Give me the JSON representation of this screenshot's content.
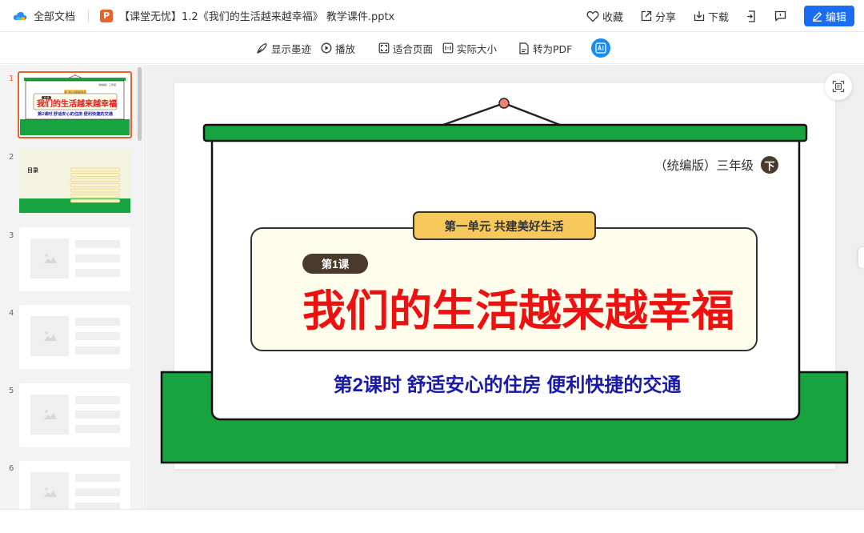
{
  "header": {
    "all_docs": "全部文档",
    "file_badge": "P",
    "doc_title": "【课堂无忧】1.2《我们的生活越来越幸福》 教学课件.pptx",
    "favorite": "收藏",
    "share": "分享",
    "download": "下载",
    "edit": "编辑"
  },
  "toolbar": {
    "show_ink": "显示墨迹",
    "play": "播放",
    "fit_page": "适合页面",
    "actual_size": "实际大小",
    "to_pdf": "转为PDF"
  },
  "thumbnails": {
    "numbers": [
      "1",
      "2",
      "3",
      "4",
      "5",
      "6"
    ],
    "t1_unit": "第一单元 共建美好生活",
    "t1_lesson": "第1课",
    "t1_title": "我们的生活越来越幸福",
    "t1_sub": "第2课时 舒适安心的住房 便利快捷的交通",
    "t1_grade": "（统编版）三年级",
    "t2_title": "目录"
  },
  "slide": {
    "grade": "（统编版）三年级",
    "grade_badge": "下",
    "unit": "第一单元  共建美好生活",
    "lesson": "第1课",
    "title": "我们的生活越来越幸福",
    "subtitle": "第2课时  舒适安心的住房  便利快捷的交通"
  },
  "colors": {
    "accent_orange": "#e8622a",
    "primary_blue": "#1a6cf0",
    "board_green": "#16a340",
    "title_red": "#ee1111",
    "subtitle_blue": "#1a1aa8",
    "tag_yellow": "#f7c95c",
    "cream": "#fffdec",
    "dark_badge": "#4a3a2c"
  }
}
